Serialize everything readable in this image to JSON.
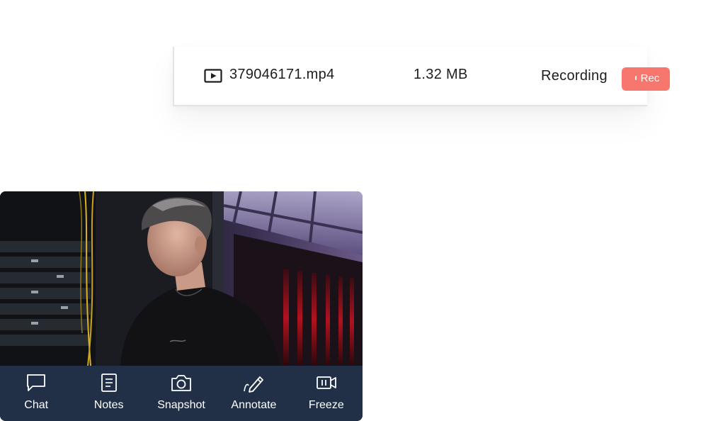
{
  "recording": {
    "file_icon": "play-file-icon",
    "file_name": "379046171.mp4",
    "file_size": "1.32 MB",
    "status": "Recording",
    "rec_button_label": "Rec",
    "accent_color": "#f7776e"
  },
  "video": {
    "image": "person-in-server-room",
    "toolbar_color": "#223047",
    "tools": [
      {
        "label": "Chat",
        "icon": "chat-icon"
      },
      {
        "label": "Notes",
        "icon": "notes-icon"
      },
      {
        "label": "Snapshot",
        "icon": "camera-icon"
      },
      {
        "label": "Annotate",
        "icon": "pen-icon"
      },
      {
        "label": "Freeze",
        "icon": "freeze-icon"
      }
    ]
  }
}
